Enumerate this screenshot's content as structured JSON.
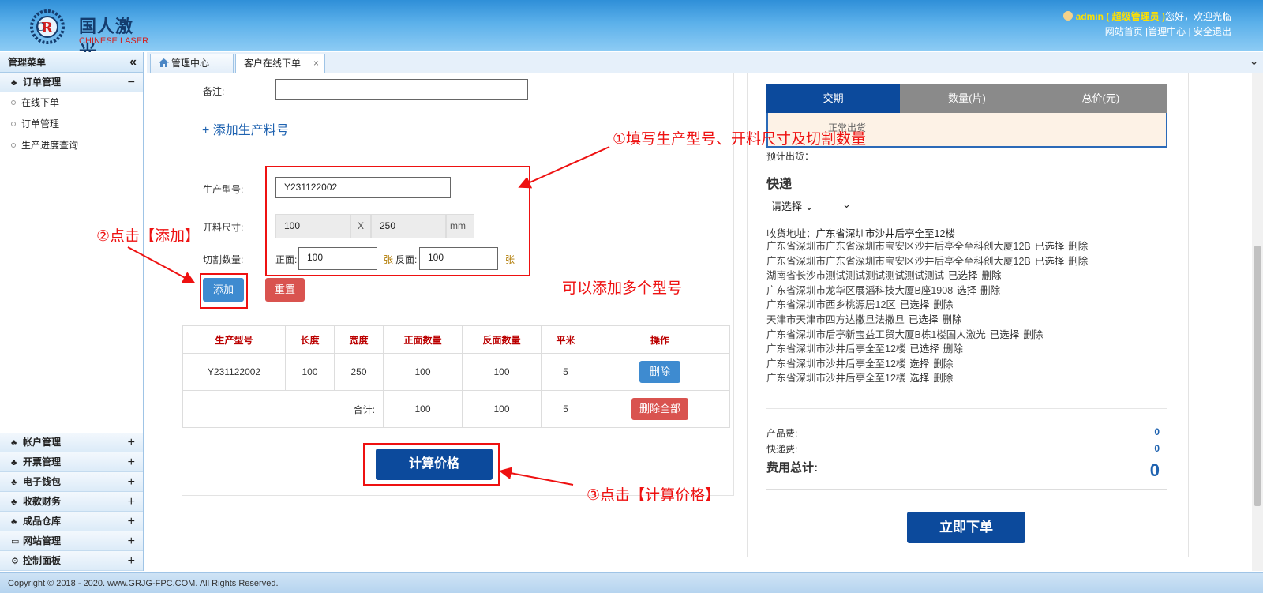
{
  "header": {
    "logo_cn": "国人激光",
    "logo_en": "CHINESE LASER",
    "user": "admin",
    "role": "( 超级管理员 )",
    "greeting": "您好，欢迎光临",
    "links": [
      "网站首页",
      "|管理中心",
      "|",
      "安全退出"
    ]
  },
  "sidebar": {
    "title": "管理菜单",
    "collapse_glyph": "«",
    "order_group": {
      "label": "订单管理",
      "toggle": "−"
    },
    "items": [
      "在线下单",
      "订单管理",
      "生产进度查询"
    ],
    "groups": [
      {
        "label": "帐户管理",
        "toggle": "+"
      },
      {
        "label": "开票管理",
        "toggle": "+"
      },
      {
        "label": "电子钱包",
        "toggle": "+"
      },
      {
        "label": "收款财务",
        "toggle": "+"
      },
      {
        "label": "成品仓库",
        "toggle": "+"
      },
      {
        "label": "网站管理",
        "toggle": "+"
      },
      {
        "label": "控制面板",
        "toggle": "+"
      }
    ]
  },
  "tabs": [
    {
      "label": "管理中心"
    },
    {
      "label": "客户在线下单",
      "close": "×"
    }
  ],
  "form": {
    "remark_label": "备注:",
    "remark_value": "",
    "add_part_link": "+ 添加生产料号",
    "model_label": "生产型号:",
    "model_value": "Y231122002",
    "size_label": "开料尺寸:",
    "size_w": "100",
    "size_x": "X",
    "size_h": "250",
    "size_unit": "mm",
    "qty_label": "切割数量:",
    "front_label": "正面:",
    "front_value": "100",
    "sheet_unit": "张",
    "back_label": "反面:",
    "back_value": "100",
    "add_button": "添加",
    "reset_button": "重置",
    "calc_button": "计算价格"
  },
  "table": {
    "headers": [
      "生产型号",
      "长度",
      "宽度",
      "正面数量",
      "反面数量",
      "平米",
      "操作"
    ],
    "rows": [
      {
        "model": "Y231122002",
        "length": "100",
        "width": "250",
        "front": "100",
        "back": "100",
        "sqm": "5",
        "action": "删除"
      }
    ],
    "total": {
      "label": "合计:",
      "front": "100",
      "back": "100",
      "sqm": "5",
      "action": "删除全部"
    }
  },
  "right": {
    "col_headers": [
      "交期",
      "数量(片)",
      "总价(元)"
    ],
    "delivery_text": "正常出货",
    "expected_label": "预计出货：",
    "express_title": "快递",
    "express_select": "请选择",
    "address_label": "收货地址：",
    "address_value": "广东省深圳市沙井后亭全至12楼",
    "addresses": [
      {
        "text": "广东省深圳市广东省深圳市宝安区沙井后亭全至科创大厦12B",
        "s": "已选择",
        "d": "删除"
      },
      {
        "text": "广东省深圳市广东省深圳市宝安区沙井后亭全至科创大厦12B",
        "s": "已选择",
        "d": "删除"
      },
      {
        "text": "湖南省长沙市测试测试测试测试测试测试",
        "s": "已选择",
        "d": "删除"
      },
      {
        "text": "广东省深圳市龙华区展滔科技大厦B座1908",
        "s": "选择",
        "d": "删除"
      },
      {
        "text": "广东省深圳市西乡桃源居12区",
        "s": "已选择",
        "d": "删除"
      },
      {
        "text": "天津市天津市四方达撒旦法撒旦",
        "s": "已选择",
        "d": "删除"
      },
      {
        "text": "广东省深圳市后亭新宝益工贸大厦B栋1楼国人激光",
        "s": "已选择",
        "d": "删除"
      },
      {
        "text": "广东省深圳市沙井后亭全至12楼",
        "s": "已选择",
        "d": "删除"
      },
      {
        "text": "广东省深圳市沙井后亭全至12楼",
        "s": "选择",
        "d": "删除"
      },
      {
        "text": "广东省深圳市沙井后亭全至12楼",
        "s": "选择",
        "d": "删除"
      }
    ],
    "product_fee_label": "产品费:",
    "product_fee": "0",
    "express_fee_label": "快递费:",
    "express_fee": "0",
    "total_label": "费用总计:",
    "total_value": "0",
    "order_button": "立即下单"
  },
  "annotations": {
    "step1": "①填写生产型号、开料尺寸及切割数量",
    "step2": "②点击【添加】",
    "step3": "③点击【计算价格】",
    "multi": "可以添加多个型号"
  },
  "footer": "Copyright © 2018 - 2020. www.GRJG-FPC.COM. All Rights Reserved.",
  "colors": {
    "navy": "#0c4a9c",
    "annot": "#ee1111",
    "blue_btn": "#3e8bd0",
    "red_btn": "#d9534f"
  }
}
